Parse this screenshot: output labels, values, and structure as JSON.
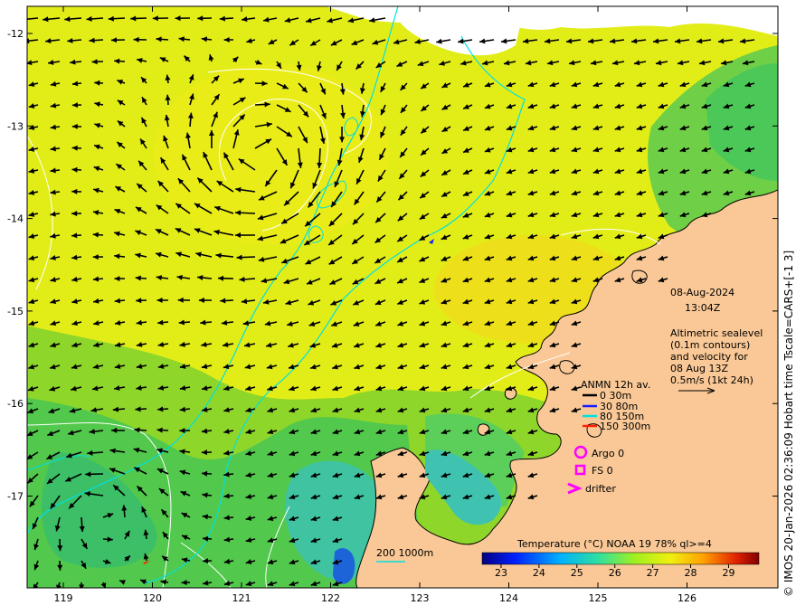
{
  "credit": "© IMOS 20-Jan-2026 02:36:09 Hobart time Tscale=CARS+[-1 3]",
  "date_box": {
    "date": "08-Aug-2024",
    "time": "13:04Z",
    "line1": "Altimetric sealevel",
    "line2": "(0.1m contours)",
    "line3": "and velocity for",
    "line4": "08 Aug 13Z",
    "line5": "0.5m/s (1kt 24h)"
  },
  "anmn_legend": {
    "title": "ANMN 12h av.",
    "items": [
      {
        "label": "0 30m",
        "color": "#000000"
      },
      {
        "label": "30 80m",
        "color": "#1a1aff"
      },
      {
        "label": "80 150m",
        "color": "#00e0e0"
      },
      {
        "label": "150 300m",
        "color": "#ff2000"
      }
    ]
  },
  "markers": {
    "argo": "Argo 0",
    "fs": "FS 0",
    "drifter": "drifter",
    "marker_color": "#ff00ff"
  },
  "isobath": {
    "label": "200  1000m",
    "color": "#00e0e0"
  },
  "colorbar": {
    "title": "Temperature (°C) NOAA 19 78% ql>=4",
    "ticks": [
      "23",
      "24",
      "25",
      "26",
      "27",
      "28",
      "29"
    ],
    "range": [
      22.5,
      29.8
    ]
  },
  "axes": {
    "x_ticks": [
      "119",
      "120",
      "121",
      "122",
      "123",
      "124",
      "125",
      "126"
    ],
    "y_ticks": [
      "-12",
      "-13",
      "-14",
      "-15",
      "-16",
      "-17"
    ]
  },
  "colors": {
    "land": "#f9c896",
    "sea_warm": "#ecee18",
    "sea_mid": "#b7e420",
    "sea_cool": "#55cc55",
    "contour": "#ffffff",
    "isobath": "#00e0e0"
  }
}
